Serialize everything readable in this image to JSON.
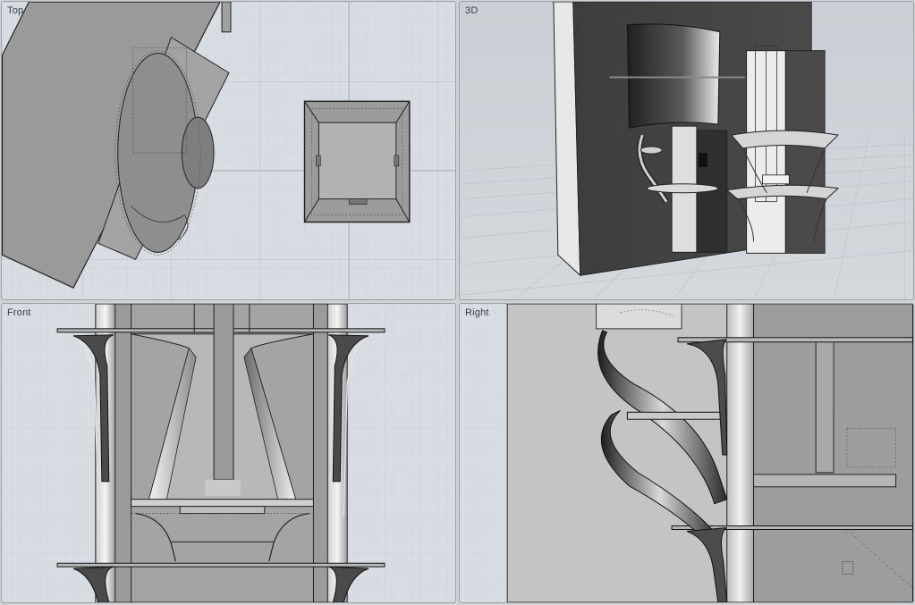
{
  "viewports": {
    "top": {
      "label": "Top"
    },
    "perspective": {
      "label": "3D"
    },
    "front": {
      "label": "Front"
    },
    "right": {
      "label": "Right"
    }
  },
  "colors": {
    "viewport_bg": "#d7dde2",
    "grid_minor": "#c6cdd3",
    "grid_major": "#b4bcc3",
    "object_fill": "#8f8f8f",
    "object_dark": "#3a3a3a",
    "outline": "#1b1b1b"
  }
}
